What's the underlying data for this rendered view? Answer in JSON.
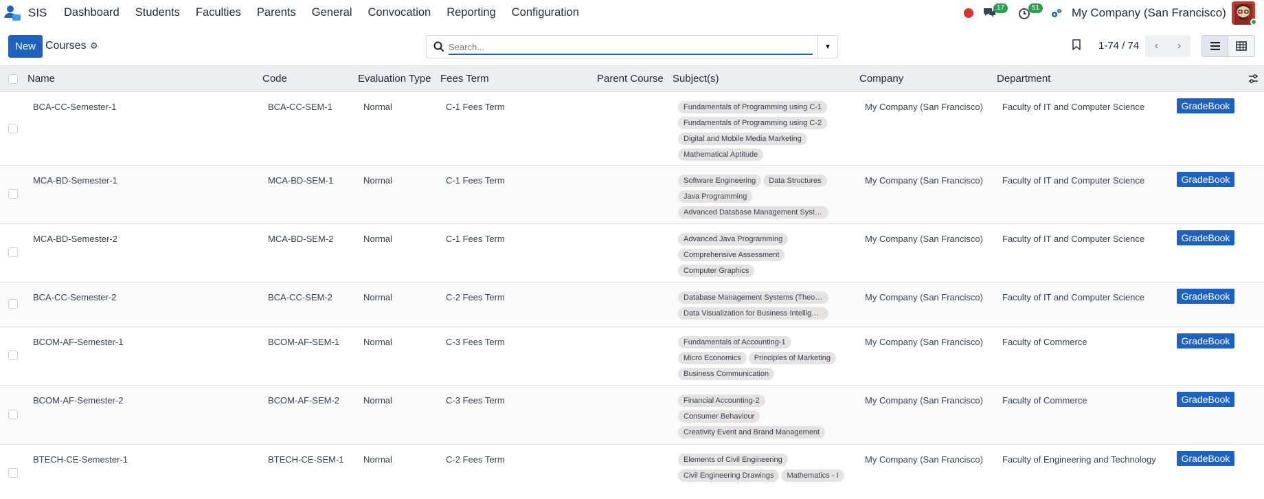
{
  "navbar": {
    "app_name": "SIS",
    "menu": [
      "Dashboard",
      "Students",
      "Faculties",
      "Parents",
      "General",
      "Convocation",
      "Reporting",
      "Configuration"
    ],
    "messages_count": "17",
    "activities_count": "51",
    "company": "My Company (San Francisco)",
    "icons": [
      "app-logo-icon",
      "record-icon",
      "chat-icon",
      "clock-icon",
      "company-switch-icon"
    ]
  },
  "control": {
    "new_label": "New",
    "title": "Courses",
    "search_placeholder": "Search...",
    "pager": "1-74 / 74"
  },
  "table": {
    "columns": [
      "Name",
      "Code",
      "Evaluation Type",
      "Fees Term",
      "Parent Course",
      "Subject(s)",
      "Company",
      "Department"
    ],
    "action_label": "GradeBook",
    "rows": [
      {
        "name": "BCA-CC-Semester-1",
        "code": "BCA-CC-SEM-1",
        "eval": "Normal",
        "fees": "C-1 Fees Term",
        "parent": "",
        "subjects": [
          "Fundamentals of Programming using C-1",
          "Fundamentals of Programming using C-2",
          "Digital and Mobile Media Marketing",
          "Mathematical Aptitude"
        ],
        "company": "My Company (San Francisco)",
        "department": "Faculty of IT and Computer Science"
      },
      {
        "name": "MCA-BD-Semester-1",
        "code": "MCA-BD-SEM-1",
        "eval": "Normal",
        "fees": "C-1 Fees Term",
        "parent": "",
        "subjects": [
          "Software Engineering",
          "Data Structures",
          "Java Programming",
          "Advanced Database Management Systems"
        ],
        "company": "My Company (San Francisco)",
        "department": "Faculty of IT and Computer Science"
      },
      {
        "name": "MCA-BD-Semester-2",
        "code": "MCA-BD-SEM-2",
        "eval": "Normal",
        "fees": "C-1 Fees Term",
        "parent": "",
        "subjects": [
          "Advanced Java Programming",
          "Comprehensive Assessment",
          "Computer Graphics"
        ],
        "company": "My Company (San Francisco)",
        "department": "Faculty of IT and Computer Science"
      },
      {
        "name": "BCA-CC-Semester-2",
        "code": "BCA-CC-SEM-2",
        "eval": "Normal",
        "fees": "C-2 Fees Term",
        "parent": "",
        "subjects": [
          "Database Management Systems (Theory)",
          "Data Visualization for Business Intelligence"
        ],
        "company": "My Company (San Francisco)",
        "department": "Faculty of IT and Computer Science"
      },
      {
        "name": "BCOM-AF-Semester-1",
        "code": "BCOM-AF-SEM-1",
        "eval": "Normal",
        "fees": "C-3 Fees Term",
        "parent": "",
        "subjects": [
          "Fundamentals of Accounting-1",
          "Micro Economics",
          "Principles of Marketing",
          "Business Communication"
        ],
        "company": "My Company (San Francisco)",
        "department": "Faculty of Commerce"
      },
      {
        "name": "BCOM-AF-Semester-2",
        "code": "BCOM-AF-SEM-2",
        "eval": "Normal",
        "fees": "C-3 Fees Term",
        "parent": "",
        "subjects": [
          "Financial Accounting-2",
          "Consumer Behaviour",
          "Creativity Event and Brand Management"
        ],
        "company": "My Company (San Francisco)",
        "department": "Faculty of Commerce"
      },
      {
        "name": "BTECH-CE-Semester-1",
        "code": "BTECH-CE-SEM-1",
        "eval": "Normal",
        "fees": "C-2 Fees Term",
        "parent": "",
        "subjects": [
          "Elements of Civil Engineering",
          "Civil Engineering Drawings",
          "Mathematics - I"
        ],
        "company": "My Company (San Francisco)",
        "department": "Faculty of Engineering and Technology"
      }
    ]
  },
  "colors": {
    "primary": "#1d62c0",
    "badge": "#2e9e4f",
    "record": "#e0312e",
    "tag_bg": "#e5e2e2"
  }
}
